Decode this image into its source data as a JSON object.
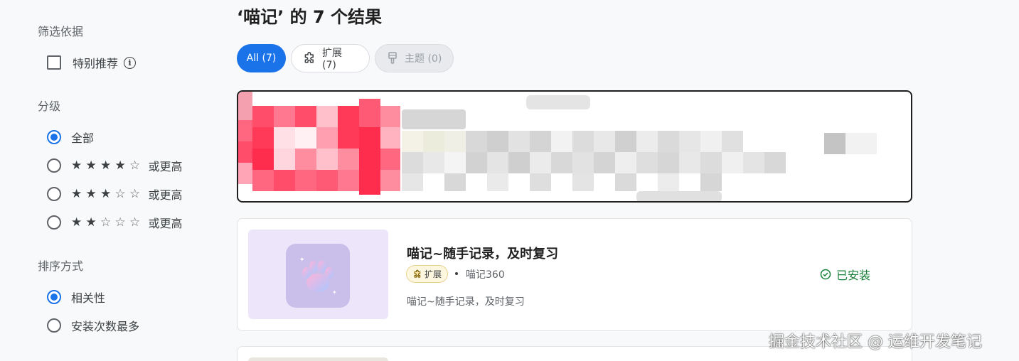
{
  "sidebar": {
    "filter_section": {
      "title": "筛选依据",
      "featured_label": "特别推荐",
      "info_symbol": "i"
    },
    "rating_section": {
      "title": "分级",
      "options": [
        {
          "label": "全部",
          "selected": true,
          "stars": null
        },
        {
          "label": "或更高",
          "selected": false,
          "stars": 4
        },
        {
          "label": "或更高",
          "selected": false,
          "stars": 3
        },
        {
          "label": "或更高",
          "selected": false,
          "stars": 2
        }
      ]
    },
    "sort_section": {
      "title": "排序方式",
      "options": [
        {
          "label": "相关性",
          "selected": true
        },
        {
          "label": "安装次数最多",
          "selected": false
        }
      ]
    }
  },
  "main": {
    "results_title": "‘喵记’ 的 7 个结果",
    "chips": [
      {
        "label": "All (7)",
        "active": true,
        "icon": null
      },
      {
        "label": "扩展 (7)",
        "active": false,
        "icon": "puzzle-icon"
      },
      {
        "label": "主题 (0)",
        "active": false,
        "disabled": true,
        "icon": "brush-icon"
      }
    ],
    "results": [
      {
        "redacted": true
      },
      {
        "title": "喵记~随手记录，及时复习",
        "badge": "扩展",
        "badge_icon": "puzzle-icon",
        "publisher": "喵记360",
        "description": "喵记~随手记录，及时复习",
        "status": "已安装",
        "status_icon": "check-circle-icon",
        "thumbnail_icon": "paw-icon"
      }
    ]
  },
  "watermark": "掘金技术社区 @ 运维开发笔记",
  "colors": {
    "accent": "#1a73e8",
    "installed": "#188038",
    "badge_bg": "#fef7e0"
  }
}
